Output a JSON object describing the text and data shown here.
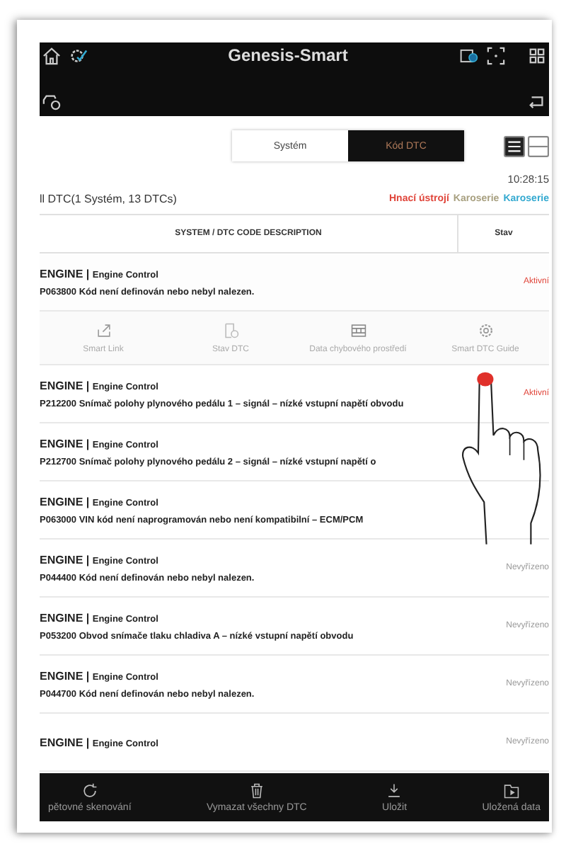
{
  "app_header": {
    "title": "Genesis-Smart"
  },
  "tabs": [
    {
      "label": "Systém",
      "selected": false
    },
    {
      "label": "Kód DTC",
      "selected": true
    }
  ],
  "view_toggle": [
    {
      "kind": "list",
      "selected": true
    },
    {
      "kind": "split",
      "selected": false
    }
  ],
  "time": "10:28:15",
  "summary": "ll DTC(1 Systém, 13 DTCs)",
  "legend": [
    {
      "label": "Hnací ústrojí",
      "color": "#e0453a"
    },
    {
      "label": "Karoserie",
      "color": "#a8a080"
    },
    {
      "label": "Karoserie",
      "color": "#33a9d0"
    }
  ],
  "table": {
    "columns": [
      "SYSTEM / DTC CODE DESCRIPTION",
      "Stav"
    ],
    "rows": [
      {
        "system": "ENGINE |",
        "module": "Engine Control",
        "description": "P063800 Kód není definován nebo nebyl nalezen.",
        "status": "Aktivní",
        "color": "#e0453a",
        "expanded": true,
        "actions": [
          {
            "kind": "share",
            "label": "Smart Link"
          },
          {
            "kind": "status",
            "label": "Stav DTC"
          },
          {
            "kind": "film",
            "label": "Data chybového prostředí"
          },
          {
            "kind": "gear",
            "label": "Smart DTC Guide"
          }
        ]
      },
      {
        "system": "ENGINE |",
        "module": "Engine Control",
        "description": "P212200 Snímač polohy plynového pedálu 1 – signál – nízké vstupní napětí obvodu",
        "status": "Aktivní",
        "color": "#e0453a",
        "expanded": false
      },
      {
        "system": "ENGINE |",
        "module": "Engine Control",
        "description": "P212700 Snímač polohy plynového pedálu 2 – signál – nízké vstupní napětí o",
        "expanded": false
      },
      {
        "system": "ENGINE |",
        "module": "Engine Control",
        "description": "P063000 VIN kód není naprogramován nebo není kompatibilní – ECM/PCM",
        "expanded": false
      },
      {
        "system": "ENGINE |",
        "module": "Engine Control",
        "description": "P044400 Kód není definován nebo nebyl nalezen.",
        "status": "Nevyřízeno",
        "color": "#999999",
        "expanded": false
      },
      {
        "system": "ENGINE |",
        "module": "Engine Control",
        "description": "P053200 Obvod snímače tlaku chladiva A – nízké vstupní napětí obvodu",
        "status": "Nevyřízeno",
        "color": "#999999",
        "expanded": false
      },
      {
        "system": "ENGINE |",
        "module": "Engine Control",
        "description": "P044700 Kód není definován nebo nebyl nalezen.",
        "status": "Nevyřízeno",
        "color": "#999999",
        "expanded": false
      },
      {
        "system": "ENGINE |",
        "module": "Engine Control",
        "status": "Nevyřízeno",
        "color": "#999999",
        "expanded": false
      }
    ]
  },
  "bottom_bar": [
    {
      "kind": "rescan",
      "label": "pětovné skenování"
    },
    {
      "kind": "delete",
      "label": "Vymazat všechny DTC"
    },
    {
      "kind": "save",
      "label": "Uložit"
    },
    {
      "kind": "saved",
      "label": "Uložená data"
    }
  ]
}
